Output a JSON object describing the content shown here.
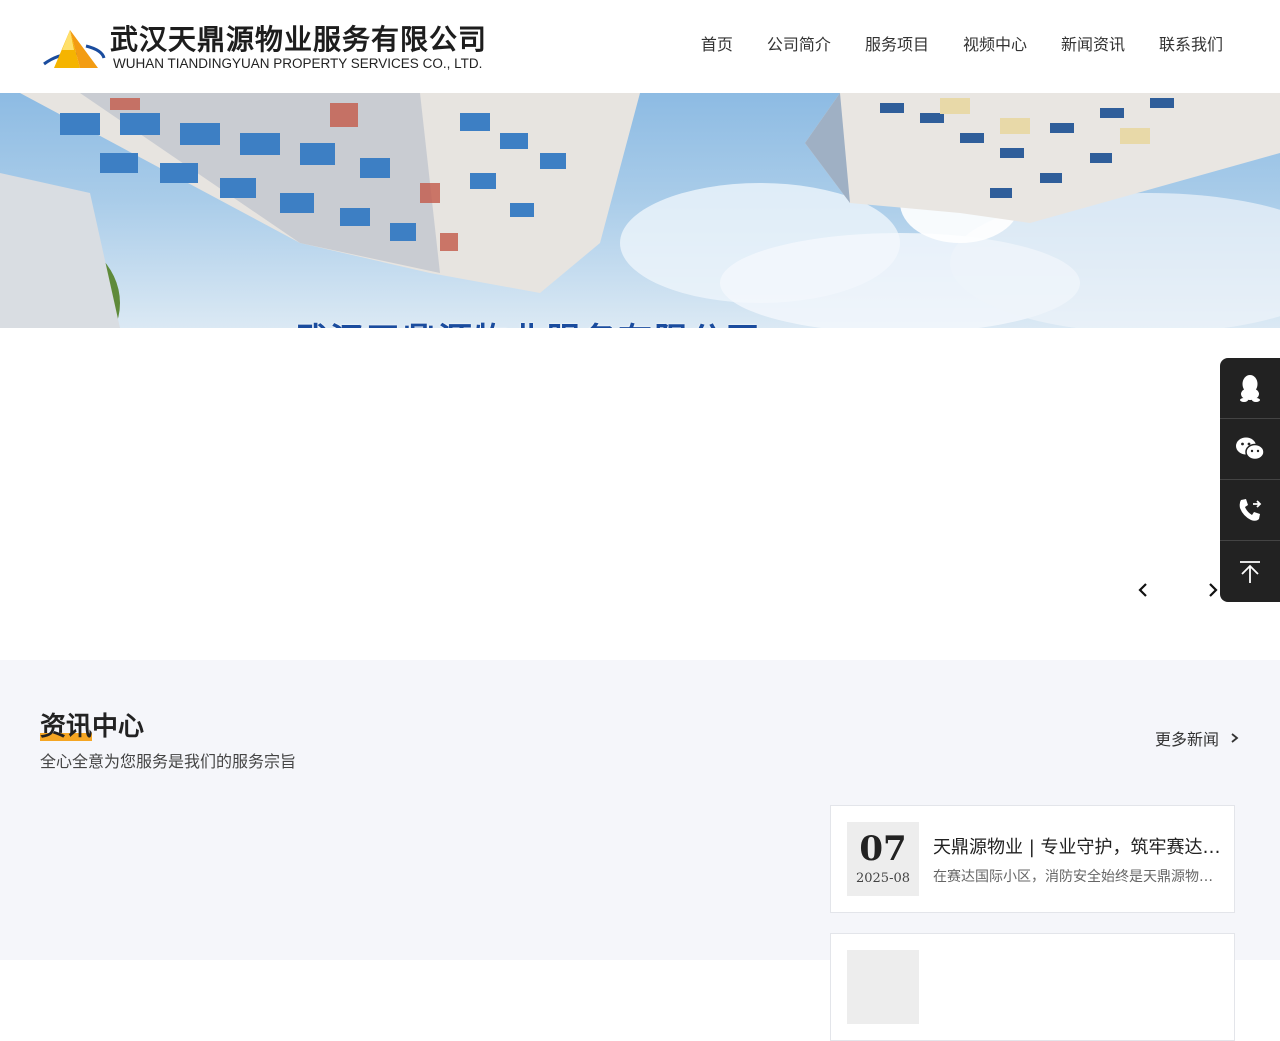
{
  "header": {
    "company_cn": "武汉天鼎源物业服务有限公司",
    "company_en": "WUHAN TIANDINGYUAN PROPERTY SERVICES CO., LTD.",
    "nav": [
      {
        "label": "首页"
      },
      {
        "label": "公司简介"
      },
      {
        "label": "服务项目"
      },
      {
        "label": "视频中心"
      },
      {
        "label": "新闻资讯"
      },
      {
        "label": "联系我们"
      }
    ]
  },
  "banner": {
    "title": "武汉天鼎源物业服务有限公司"
  },
  "carousel": {
    "prev_icon": "chevron-left-icon",
    "next_icon": "chevron-right-icon"
  },
  "sidebar": {
    "items": [
      {
        "icon": "qq-icon"
      },
      {
        "icon": "wechat-icon"
      },
      {
        "icon": "phone-icon"
      },
      {
        "icon": "back-to-top-icon"
      }
    ]
  },
  "news": {
    "title_highlight": "资讯",
    "title_rest": "中心",
    "subtitle": "全心全意为您服务是我们的服务宗旨",
    "more_label": "更多新闻",
    "items": [
      {
        "day": "07",
        "year_month": "2025-08",
        "title": "天鼎源物业 | 专业守护，筑牢赛达国际消防安全防线",
        "desc": "在赛达国际小区，消防安全始终是天鼎源物业工作的重中之重"
      }
    ]
  },
  "colors": {
    "accent": "#f5a623",
    "sidebar_bg": "#222222",
    "banner_text": "#1a4c9e"
  }
}
